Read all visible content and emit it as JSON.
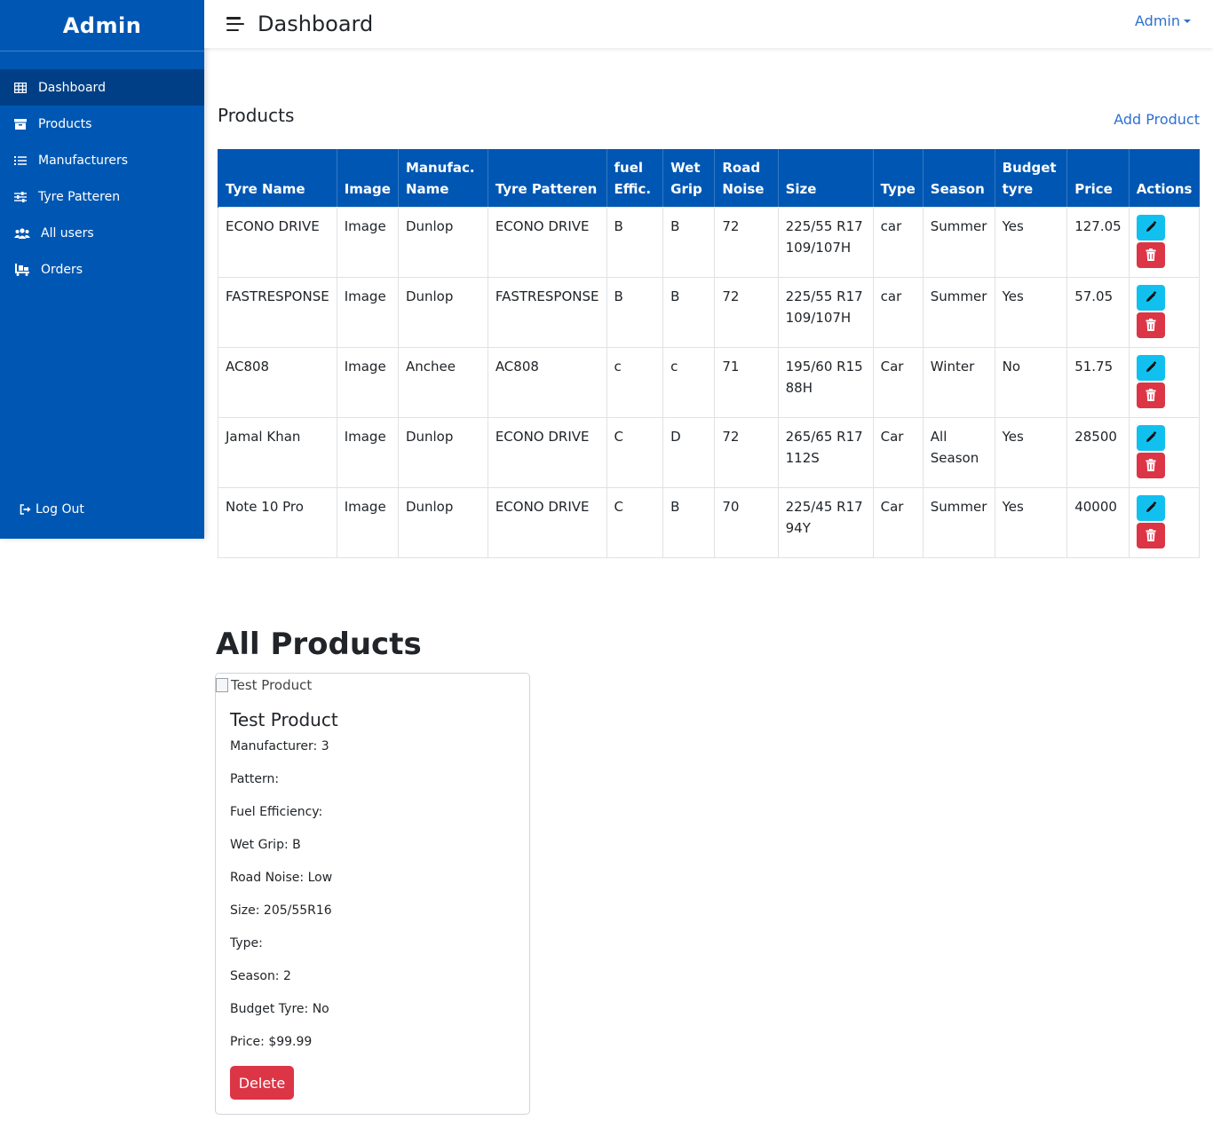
{
  "sidebar": {
    "brand": "Admin",
    "items": [
      {
        "label": "Dashboard",
        "icon": "table-icon"
      },
      {
        "label": "Products",
        "icon": "archive-icon"
      },
      {
        "label": "Manufacturers",
        "icon": "list-icon"
      },
      {
        "label": "Tyre Patteren",
        "icon": "sliders-icon"
      },
      {
        "label": "All users",
        "icon": "users-icon"
      },
      {
        "label": "Orders",
        "icon": "dolly-icon"
      }
    ],
    "logout": "Log Out"
  },
  "topbar": {
    "title": "Dashboard",
    "user": "Admin"
  },
  "products_section": {
    "title": "Products",
    "add_link": "Add Product",
    "headers": [
      [
        "Tyre Name"
      ],
      [
        "Image"
      ],
      [
        "Manufac.",
        "Name"
      ],
      [
        "Tyre Patteren"
      ],
      [
        "fuel",
        "Effic."
      ],
      [
        "Wet",
        "Grip"
      ],
      [
        "Road",
        "Noise"
      ],
      [
        "Size"
      ],
      [
        "Type"
      ],
      [
        "Season"
      ],
      [
        "Budget",
        "tyre"
      ],
      [
        "Price"
      ],
      [
        "Actions"
      ]
    ],
    "rows": [
      {
        "name": "ECONO DRIVE",
        "image": "Image",
        "manufacturer": "Dunlop",
        "pattern": "ECONO DRIVE",
        "fuel": "B",
        "wet": "B",
        "noise": "72",
        "size1": "225/55 R17",
        "size2": "109/107H",
        "type": "car",
        "season1": "Summer",
        "season2": "",
        "budget": "Yes",
        "price": "127.05"
      },
      {
        "name": "FASTRESPONSE",
        "image": "Image",
        "manufacturer": "Dunlop",
        "pattern": "FASTRESPONSE",
        "fuel": "B",
        "wet": "B",
        "noise": "72",
        "size1": "225/55 R17",
        "size2": "109/107H",
        "type": "car",
        "season1": "Summer",
        "season2": "",
        "budget": "Yes",
        "price": "57.05"
      },
      {
        "name": "AC808",
        "image": "Image",
        "manufacturer": "Anchee",
        "pattern": "AC808",
        "fuel": "c",
        "wet": "c",
        "noise": "71",
        "size1": "195/60 R15",
        "size2": "88H",
        "type": "Car",
        "season1": "Winter",
        "season2": "",
        "budget": "No",
        "price": "51.75"
      },
      {
        "name": "Jamal Khan",
        "image": "Image",
        "manufacturer": "Dunlop",
        "pattern": "ECONO DRIVE",
        "fuel": "C",
        "wet": "D",
        "noise": "72",
        "size1": "265/65 R17",
        "size2": "112S",
        "type": "Car",
        "season1": "All",
        "season2": "Season",
        "budget": "Yes",
        "price": "28500"
      },
      {
        "name": "Note 10 Pro",
        "image": "Image",
        "manufacturer": "Dunlop",
        "pattern": "ECONO DRIVE",
        "fuel": "C",
        "wet": "B",
        "noise": "70",
        "size1": "225/45 R17",
        "size2": "94Y",
        "type": "Car",
        "season1": "Summer",
        "season2": "",
        "budget": "Yes",
        "price": "40000"
      }
    ]
  },
  "all_products": {
    "title": "All Products",
    "card": {
      "image_alt": "Test Product",
      "title": "Test Product",
      "fields": [
        "Manufacturer: 3",
        "Pattern:",
        "Fuel Efficiency:",
        "Wet Grip: B",
        "Road Noise: Low",
        "Size: 205/55R16",
        "Type:",
        "Season: 2",
        "Budget Tyre: No",
        "Price: $99.99"
      ],
      "delete_label": "Delete"
    }
  },
  "colors": {
    "primary": "#0057b3",
    "sidebar_active": "#003f86",
    "link": "#2f6fd1",
    "edit": "#12c0ef",
    "danger": "#dc3545"
  }
}
